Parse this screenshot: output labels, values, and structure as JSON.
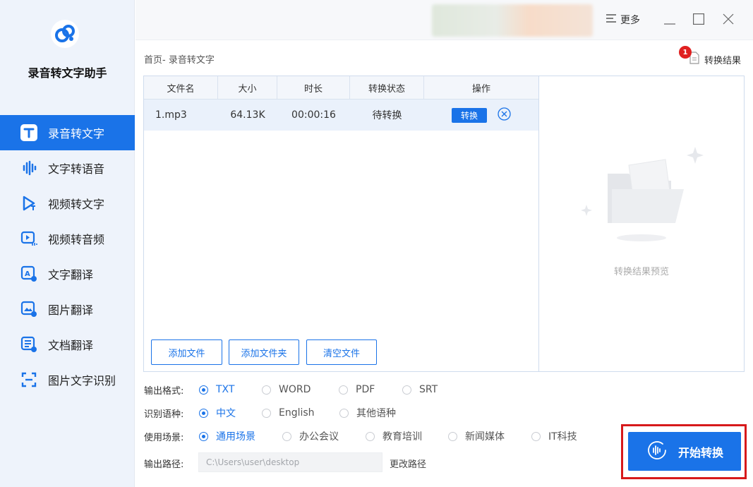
{
  "app": {
    "title": "录音转文字助手"
  },
  "sidebar": {
    "items": [
      {
        "label": "录音转文字",
        "icon": "text-t-icon",
        "active": true
      },
      {
        "label": "文字转语音",
        "icon": "audio-wave-icon"
      },
      {
        "label": "视频转文字",
        "icon": "video-text-icon"
      },
      {
        "label": "视频转音频",
        "icon": "video-audio-icon"
      },
      {
        "label": "文字翻译",
        "icon": "text-translate-icon"
      },
      {
        "label": "图片翻译",
        "icon": "image-translate-icon"
      },
      {
        "label": "文档翻译",
        "icon": "doc-translate-icon"
      },
      {
        "label": "图片文字识别",
        "icon": "ocr-scan-icon"
      }
    ]
  },
  "topbar": {
    "more_label": "更多"
  },
  "breadcrumb": "首页- 录音转文字",
  "results": {
    "label": "转换结果",
    "badge": "1"
  },
  "table": {
    "headers": [
      "文件名",
      "大小",
      "时长",
      "转换状态",
      "操作"
    ],
    "rows": [
      {
        "name": "1.mp3",
        "size": "64.13K",
        "duration": "00:00:16",
        "status": "待转换",
        "action": "转换"
      }
    ]
  },
  "buttons": {
    "add_file": "添加文件",
    "add_folder": "添加文件夹",
    "clear_files": "清空文件",
    "start": "开始转换",
    "change_path": "更改路径"
  },
  "preview": {
    "text": "转换结果预览"
  },
  "options": {
    "format": {
      "label": "输出格式:",
      "choices": [
        "TXT",
        "WORD",
        "PDF",
        "SRT"
      ],
      "selected": "TXT"
    },
    "language": {
      "label": "识别语种:",
      "choices": [
        "中文",
        "English",
        "其他语种"
      ],
      "selected": "中文"
    },
    "scene": {
      "label": "使用场景:",
      "choices": [
        "通用场景",
        "办公会议",
        "教育培训",
        "新闻媒体",
        "IT科技"
      ],
      "selected": "通用场景"
    },
    "path": {
      "label": "输出路径:",
      "value": "C:\\Users\\user\\desktop"
    }
  },
  "colors": {
    "accent": "#1a73e8",
    "highlight": "#d7191b",
    "sidebar_bg": "#eef3fb"
  }
}
